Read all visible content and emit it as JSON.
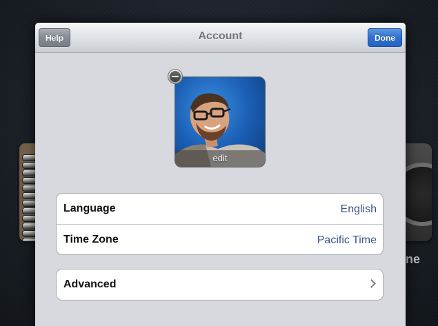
{
  "background": {
    "right_app_label": "ne"
  },
  "navbar": {
    "title": "Account",
    "help_label": "Help",
    "done_label": "Done"
  },
  "profile": {
    "edit_label": "edit"
  },
  "settings": {
    "language": {
      "label": "Language",
      "value": "English"
    },
    "time_zone": {
      "label": "Time Zone",
      "value": "Pacific Time"
    },
    "advanced": {
      "label": "Advanced"
    }
  },
  "colors": {
    "done_button": "#2f6fd0",
    "value_text": "#385487",
    "sheet_background": "#d8d9de"
  }
}
